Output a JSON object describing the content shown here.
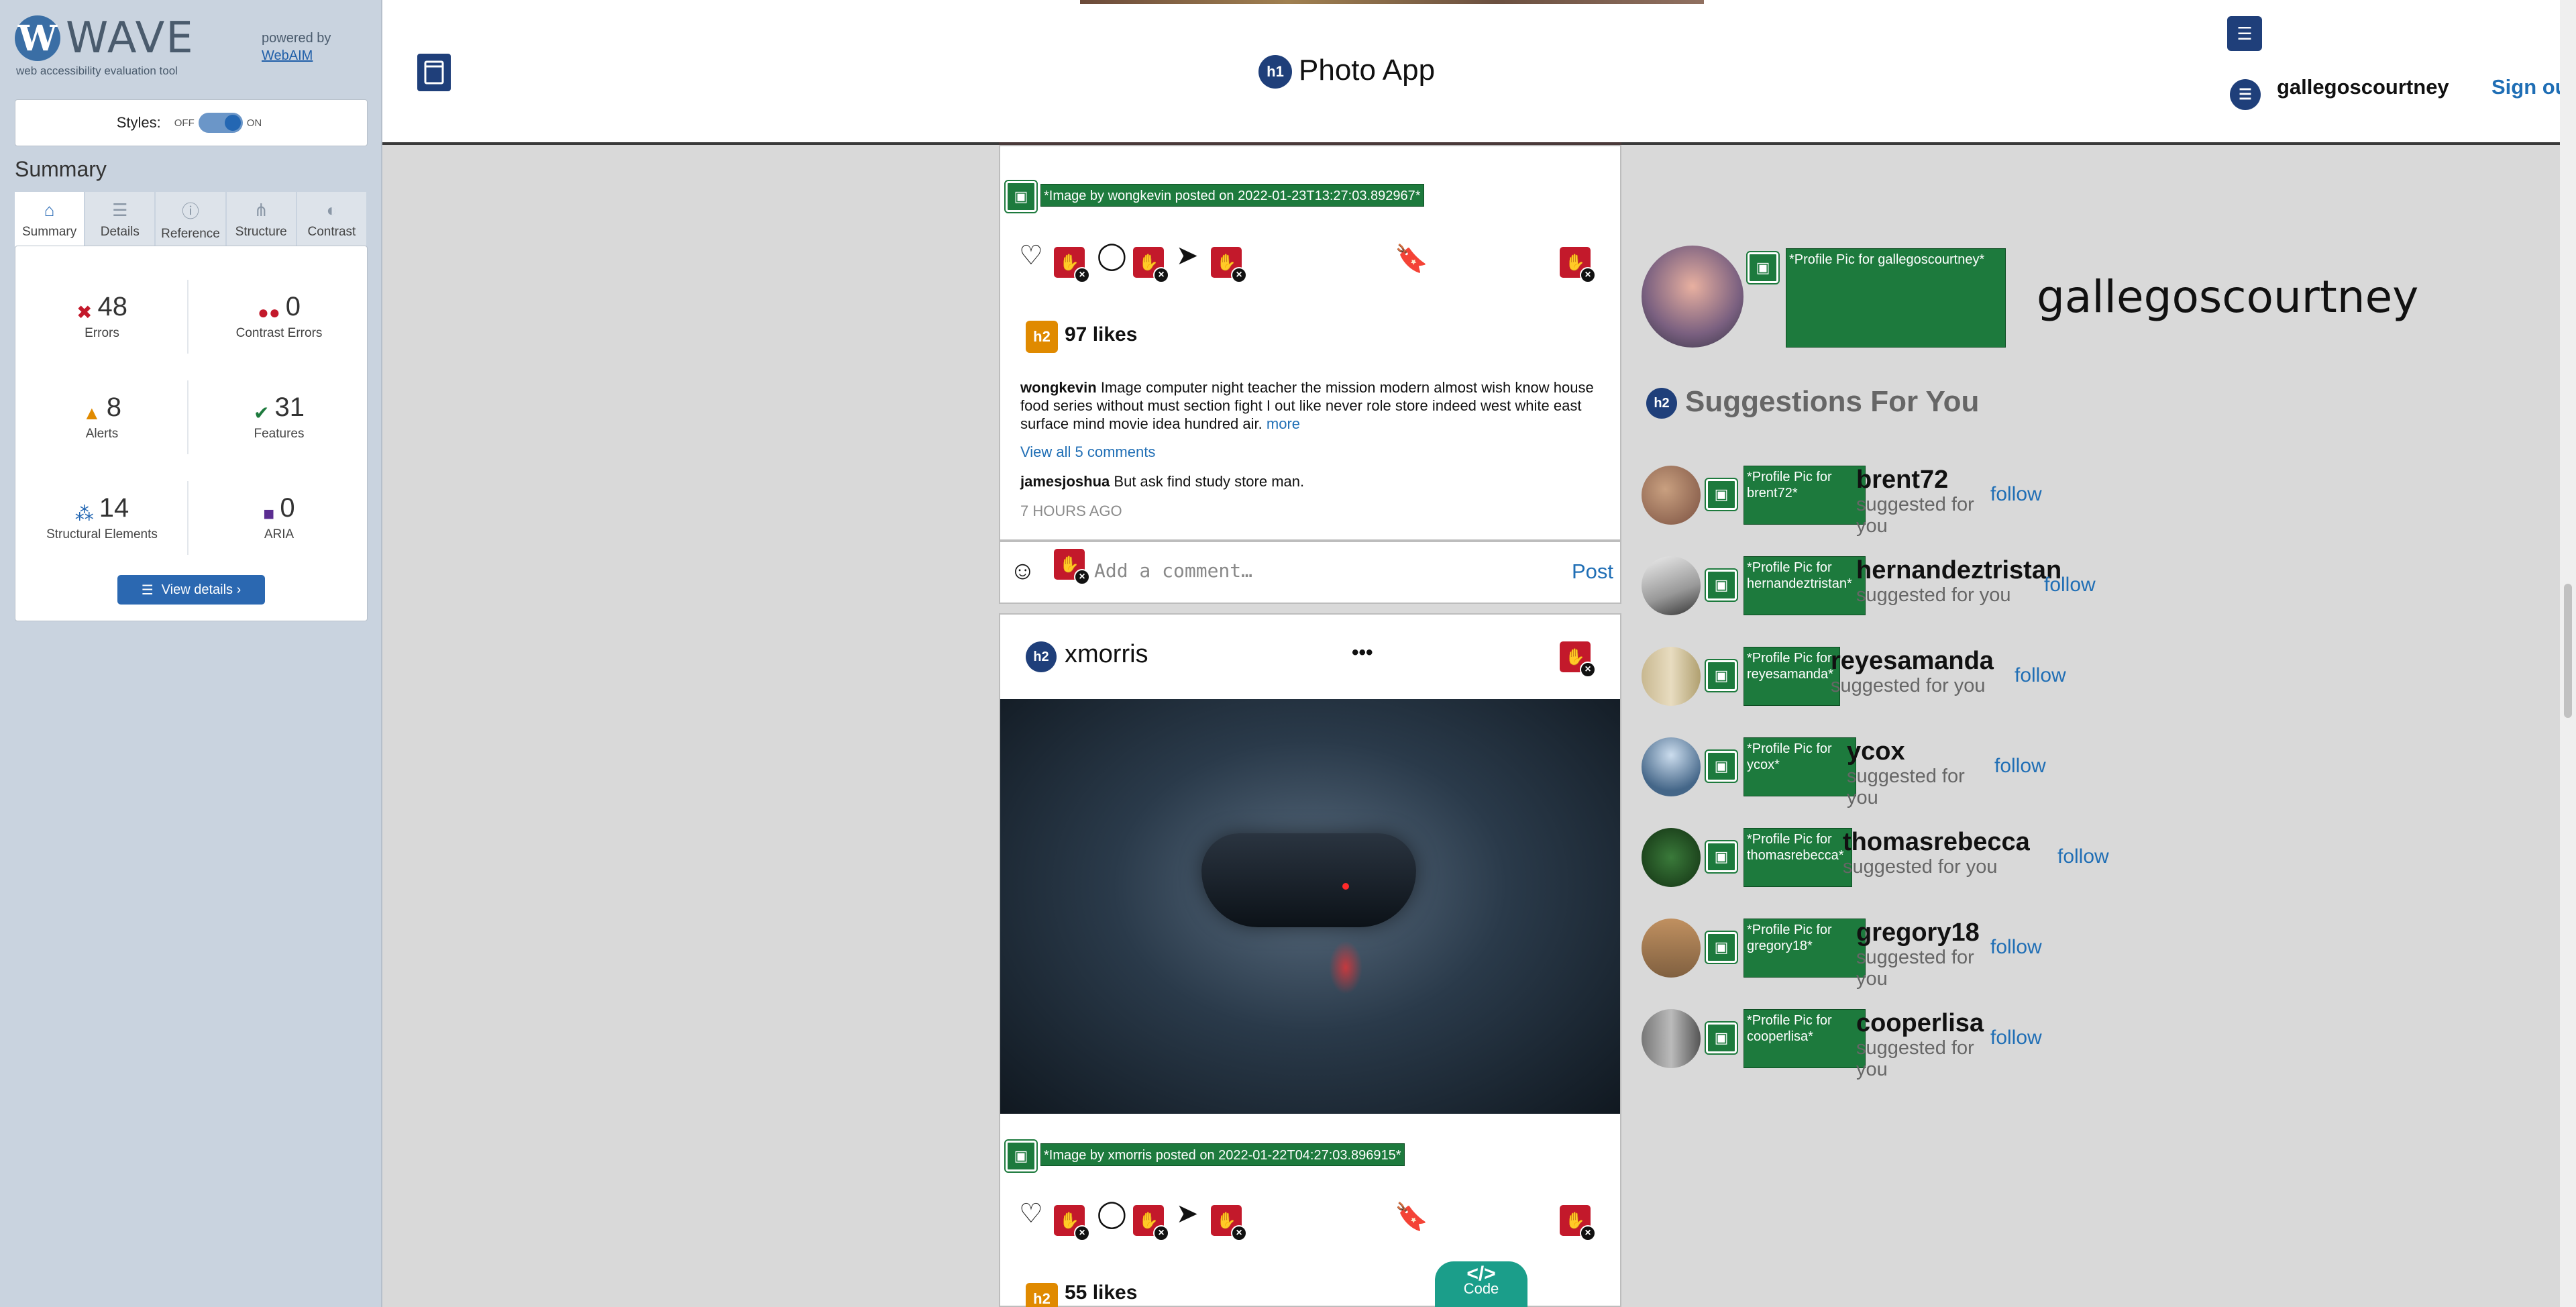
{
  "wave": {
    "logo_letter": "W",
    "logo_word": "WAVE",
    "tagline": "web accessibility evaluation tool",
    "powered_by": "powered by",
    "webaim": "WebAIM",
    "styles_label": "Styles:",
    "styles_off": "OFF",
    "styles_on": "ON",
    "summary_heading": "Summary",
    "tabs": [
      {
        "label": "Summary",
        "icon": "home-icon"
      },
      {
        "label": "Details",
        "icon": "list-icon"
      },
      {
        "label": "Reference",
        "icon": "info-icon"
      },
      {
        "label": "Structure",
        "icon": "structure-icon"
      },
      {
        "label": "Contrast",
        "icon": "contrast-icon"
      }
    ],
    "stats": {
      "errors": {
        "value": "48",
        "label": "Errors"
      },
      "contrast_errors": {
        "value": "0",
        "label": "Contrast Errors"
      },
      "alerts": {
        "value": "8",
        "label": "Alerts"
      },
      "features": {
        "value": "31",
        "label": "Features"
      },
      "structural": {
        "value": "14",
        "label": "Structural Elements"
      },
      "aria": {
        "value": "0",
        "label": "ARIA"
      }
    },
    "view_details": "View details ›"
  },
  "app": {
    "h1_badge": "h1",
    "title": "Photo App",
    "username": "gallegoscourtney",
    "sign_out": "Sign out"
  },
  "post1": {
    "alt": "*Image by wongkevin posted on 2022-01-23T13:27:03.892967*",
    "likes": "97 likes",
    "h2_badge": "h2",
    "author": "wongkevin",
    "caption": "Image computer night teacher the mission modern almost wish know house food series without must section fight I out like never role store indeed west white east surface mind movie idea hundred air.",
    "more": "more",
    "view_comments": "View all 5 comments",
    "comment_user": "jamesjoshua",
    "comment_text": "But ask find study store man.",
    "time": "7 HOURS AGO",
    "comment_placeholder": "Add a comment…",
    "post_button": "Post"
  },
  "post2": {
    "h2_badge": "h2",
    "author": "xmorris",
    "menu": "•••",
    "alt": "*Image by xmorris posted on 2022-01-22T04:27:03.896915*",
    "likes": "55 likes"
  },
  "sidebar": {
    "profile_alt": "*Profile Pic for gallegoscourtney*",
    "profile_name": "gallegoscourtney",
    "h2_badge": "h2",
    "suggestions_heading": "Suggestions For You",
    "suggestions": [
      {
        "alt": "*Profile Pic for brent72*",
        "name": "brent72",
        "sub": "suggested for you",
        "follow": "follow"
      },
      {
        "alt": "*Profile Pic for hernandeztristan*",
        "name": "hernandeztristan",
        "sub": "suggested for you",
        "follow": "follow"
      },
      {
        "alt": "*Profile Pic for reyesamanda*",
        "name": "reyesamanda",
        "sub": "suggested for you",
        "follow": "follow"
      },
      {
        "alt": "*Profile Pic for ycox*",
        "name": "ycox",
        "sub": "suggested for you",
        "follow": "follow"
      },
      {
        "alt": "*Profile Pic for thomasrebecca*",
        "name": "thomasrebecca",
        "sub": "suggested for you",
        "follow": "follow"
      },
      {
        "alt": "*Profile Pic for gregory18*",
        "name": "gregory18",
        "sub": "suggested for you",
        "follow": "follow"
      },
      {
        "alt": "*Profile Pic for cooperlisa*",
        "name": "cooperlisa",
        "sub": "suggested for you",
        "follow": "follow"
      }
    ]
  },
  "code_button": {
    "symbol": "</>",
    "label": "Code"
  }
}
